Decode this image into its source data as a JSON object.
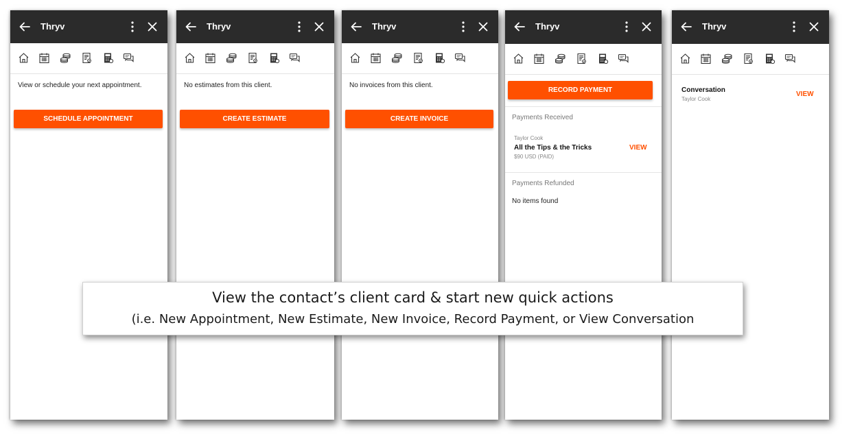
{
  "app": {
    "title": "Thryv"
  },
  "icons": {
    "header": [
      "back-arrow-icon",
      "kebab-menu-icon",
      "close-icon"
    ],
    "toolbar": [
      "home-icon",
      "calendar-icon",
      "coins-icon",
      "estimate-document-icon",
      "invoice-calculator-icon",
      "chat-icon"
    ]
  },
  "colors": {
    "accent": "#ff5000",
    "header_bg": "#2b2b2b"
  },
  "panels": {
    "appointments": {
      "message": "View or schedule your next appointment.",
      "button": "SCHEDULE APPOINTMENT"
    },
    "estimates": {
      "message": "No estimates from this client.",
      "button": "CREATE ESTIMATE"
    },
    "invoices": {
      "message": "No invoices from this client.",
      "button": "CREATE INVOICE"
    },
    "payments": {
      "button": "RECORD PAYMENT",
      "received_label": "Payments Received",
      "received_item": {
        "client": "Taylor Cook",
        "title": "All the Tips & the Tricks",
        "amount": "$90 USD (PAID)",
        "action": "VIEW"
      },
      "refunded_label": "Payments Refunded",
      "refunded_empty": "No items found"
    },
    "conversation": {
      "title": "Conversation",
      "client": "Taylor Cook",
      "action": "VIEW"
    }
  },
  "caption": {
    "line1": "View the contact’s client card & start new quick actions",
    "line2": "(i.e. New Appointment, New Estimate, New Invoice, Record Payment, or View Conversation"
  }
}
